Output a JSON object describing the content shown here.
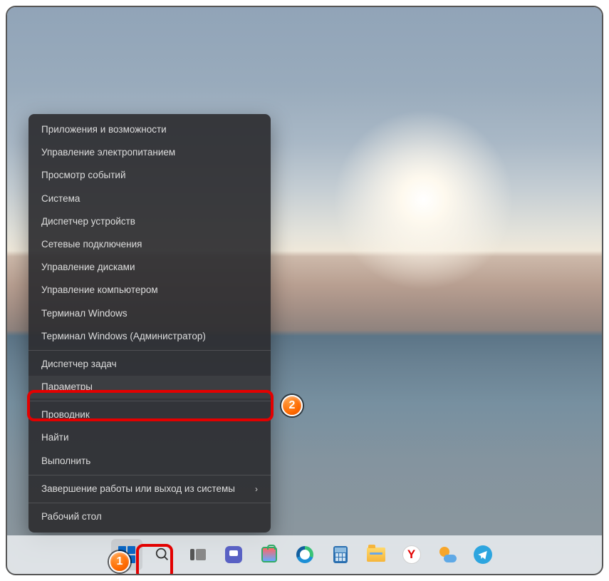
{
  "menu": {
    "items": [
      {
        "label": "Приложения и возможности"
      },
      {
        "label": "Управление электропитанием"
      },
      {
        "label": "Просмотр событий"
      },
      {
        "label": "Система"
      },
      {
        "label": "Диспетчер устройств"
      },
      {
        "label": "Сетевые подключения"
      },
      {
        "label": "Управление дисками"
      },
      {
        "label": "Управление компьютером"
      },
      {
        "label": "Терминал Windows"
      },
      {
        "label": "Терминал Windows (Администратор)"
      }
    ],
    "items2": [
      {
        "label": "Диспетчер задач"
      },
      {
        "label": "Параметры"
      }
    ],
    "items3": [
      {
        "label": "Проводник"
      },
      {
        "label": "Найти"
      },
      {
        "label": "Выполнить"
      }
    ],
    "items4": [
      {
        "label": "Завершение работы или выход из системы",
        "submenu": true
      }
    ],
    "items5": [
      {
        "label": "Рабочий стол"
      }
    ]
  },
  "callouts": {
    "badge1": "1",
    "badge2": "2"
  },
  "taskbar": {
    "yandex_letter": "Y"
  }
}
